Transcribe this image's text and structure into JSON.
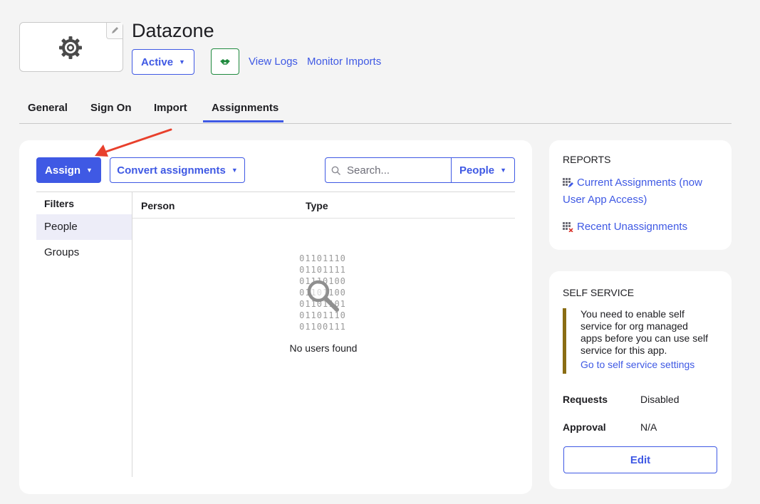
{
  "app": {
    "title": "Datazone",
    "status_label": "Active",
    "links": {
      "view_logs": "View Logs",
      "monitor_imports": "Monitor Imports"
    }
  },
  "tabs": [
    {
      "label": "General"
    },
    {
      "label": "Sign On"
    },
    {
      "label": "Import"
    },
    {
      "label": "Assignments",
      "active": true
    }
  ],
  "toolbar": {
    "assign_label": "Assign",
    "convert_label": "Convert assignments",
    "search_placeholder": "Search...",
    "search_filter_label": "People"
  },
  "filters": {
    "title": "Filters",
    "items": [
      {
        "label": "People",
        "active": true
      },
      {
        "label": "Groups"
      }
    ]
  },
  "table": {
    "columns": [
      "Person",
      "Type"
    ],
    "empty_binary": [
      "01101110",
      "01101111",
      "01110100",
      "01101100",
      "01101101",
      "01101110",
      "01100111"
    ],
    "empty_message": "No users found"
  },
  "reports": {
    "title": "REPORTS",
    "links": [
      {
        "line1": "Current Assignments (now",
        "line2": "User App Access)"
      },
      {
        "line1": "Recent Unassignments"
      }
    ]
  },
  "self_service": {
    "title": "SELF SERVICE",
    "notice_lines": [
      "You need to enable self",
      "service for org managed",
      "apps before you can use self",
      "service for this app."
    ],
    "notice_link": "Go to self service settings",
    "requests_label": "Requests",
    "requests_value": "Disabled",
    "approval_label": "Approval",
    "approval_value": "N/A",
    "edit_label": "Edit"
  },
  "colors": {
    "accent": "#3f59e4",
    "provisioning_green": "#1f8a3e",
    "notice_border": "#8a6d14",
    "annotation_arrow": "#e8402c"
  },
  "icons": [
    "gear-icon",
    "pencil-icon",
    "handshake-icon",
    "search-icon",
    "magnifier-icon",
    "report-grid-icon",
    "report-grid-x-icon",
    "caret-down-icon"
  ]
}
